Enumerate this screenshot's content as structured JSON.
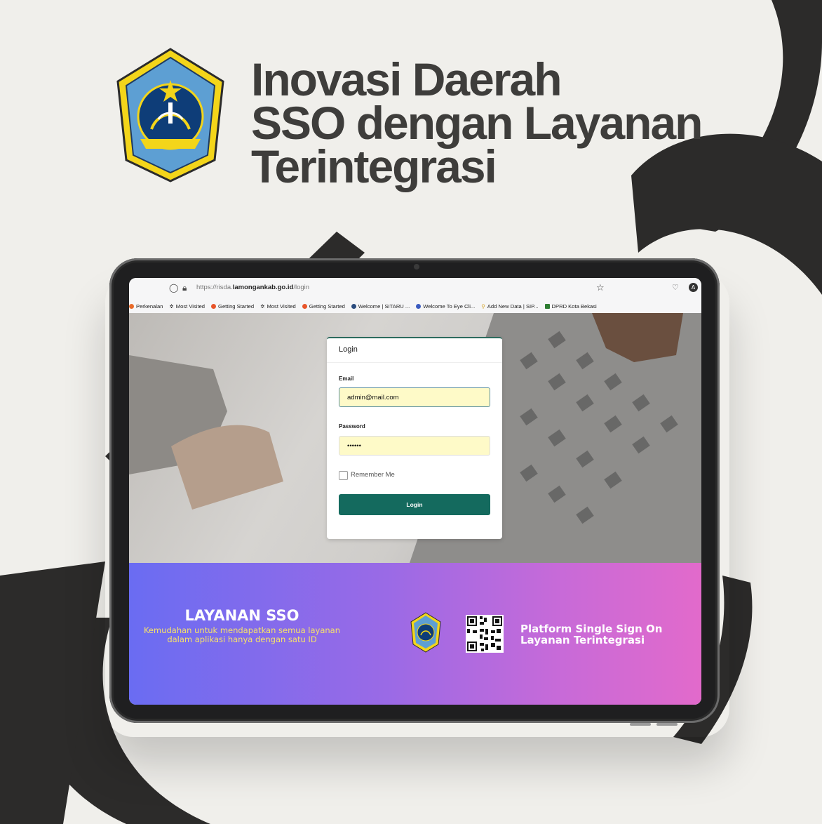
{
  "headline": {
    "line1": "Inovasi Daerah",
    "line2": "SSO dengan Layanan",
    "line3": "Terintegrasi"
  },
  "emblem": {
    "label": "LAMONGAN"
  },
  "browser": {
    "url_prefix": "https://risda.",
    "url_domain": "lamongankab.go.id",
    "url_path": "/login",
    "bookmarks": [
      "Perkenalan",
      "Most Visited",
      "Getting Started",
      "Most Visited",
      "Getting Started",
      "Welcome | SITARU ...",
      "Welcome To Eye Cli...",
      "Add New Data | SIP...",
      "DPRD Kota Bekasi"
    ],
    "avatar_letter": "A"
  },
  "login": {
    "title": "Login",
    "email_label": "Email",
    "email_value": "admin@mail.com",
    "password_label": "Password",
    "password_value": "••••••",
    "remember_label": "Remember Me",
    "button_label": "Login"
  },
  "banner": {
    "title": "LAYANAN SSO",
    "subtitle_line1": "Kemudahan untuk mendapatkan semua layanan",
    "subtitle_line2": "dalam aplikasi hanya dengan satu ID",
    "right_line1": "Platform Single Sign On",
    "right_line2": "Layanan Terintegrasi"
  },
  "colors": {
    "background": "#f0efeb",
    "headline": "#3e3d3b",
    "deco_letters": "#2c2b2a",
    "login_button": "#146a5e",
    "input_autofill": "#fefac8",
    "banner_start": "#6a6cf2",
    "banner_end": "#e26acb",
    "banner_subtitle": "#f7e26a"
  }
}
